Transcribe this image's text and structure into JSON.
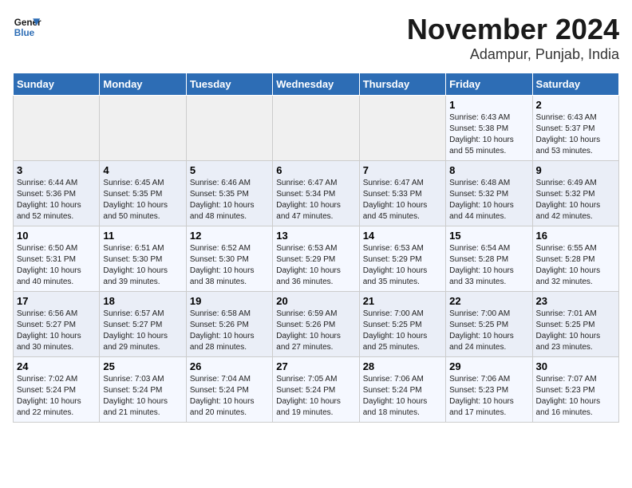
{
  "header": {
    "logo_line1": "General",
    "logo_line2": "Blue",
    "month": "November 2024",
    "location": "Adampur, Punjab, India"
  },
  "weekdays": [
    "Sunday",
    "Monday",
    "Tuesday",
    "Wednesday",
    "Thursday",
    "Friday",
    "Saturday"
  ],
  "weeks": [
    [
      {
        "day": "",
        "info": ""
      },
      {
        "day": "",
        "info": ""
      },
      {
        "day": "",
        "info": ""
      },
      {
        "day": "",
        "info": ""
      },
      {
        "day": "",
        "info": ""
      },
      {
        "day": "1",
        "info": "Sunrise: 6:43 AM\nSunset: 5:38 PM\nDaylight: 10 hours and 55 minutes."
      },
      {
        "day": "2",
        "info": "Sunrise: 6:43 AM\nSunset: 5:37 PM\nDaylight: 10 hours and 53 minutes."
      }
    ],
    [
      {
        "day": "3",
        "info": "Sunrise: 6:44 AM\nSunset: 5:36 PM\nDaylight: 10 hours and 52 minutes."
      },
      {
        "day": "4",
        "info": "Sunrise: 6:45 AM\nSunset: 5:35 PM\nDaylight: 10 hours and 50 minutes."
      },
      {
        "day": "5",
        "info": "Sunrise: 6:46 AM\nSunset: 5:35 PM\nDaylight: 10 hours and 48 minutes."
      },
      {
        "day": "6",
        "info": "Sunrise: 6:47 AM\nSunset: 5:34 PM\nDaylight: 10 hours and 47 minutes."
      },
      {
        "day": "7",
        "info": "Sunrise: 6:47 AM\nSunset: 5:33 PM\nDaylight: 10 hours and 45 minutes."
      },
      {
        "day": "8",
        "info": "Sunrise: 6:48 AM\nSunset: 5:32 PM\nDaylight: 10 hours and 44 minutes."
      },
      {
        "day": "9",
        "info": "Sunrise: 6:49 AM\nSunset: 5:32 PM\nDaylight: 10 hours and 42 minutes."
      }
    ],
    [
      {
        "day": "10",
        "info": "Sunrise: 6:50 AM\nSunset: 5:31 PM\nDaylight: 10 hours and 40 minutes."
      },
      {
        "day": "11",
        "info": "Sunrise: 6:51 AM\nSunset: 5:30 PM\nDaylight: 10 hours and 39 minutes."
      },
      {
        "day": "12",
        "info": "Sunrise: 6:52 AM\nSunset: 5:30 PM\nDaylight: 10 hours and 38 minutes."
      },
      {
        "day": "13",
        "info": "Sunrise: 6:53 AM\nSunset: 5:29 PM\nDaylight: 10 hours and 36 minutes."
      },
      {
        "day": "14",
        "info": "Sunrise: 6:53 AM\nSunset: 5:29 PM\nDaylight: 10 hours and 35 minutes."
      },
      {
        "day": "15",
        "info": "Sunrise: 6:54 AM\nSunset: 5:28 PM\nDaylight: 10 hours and 33 minutes."
      },
      {
        "day": "16",
        "info": "Sunrise: 6:55 AM\nSunset: 5:28 PM\nDaylight: 10 hours and 32 minutes."
      }
    ],
    [
      {
        "day": "17",
        "info": "Sunrise: 6:56 AM\nSunset: 5:27 PM\nDaylight: 10 hours and 30 minutes."
      },
      {
        "day": "18",
        "info": "Sunrise: 6:57 AM\nSunset: 5:27 PM\nDaylight: 10 hours and 29 minutes."
      },
      {
        "day": "19",
        "info": "Sunrise: 6:58 AM\nSunset: 5:26 PM\nDaylight: 10 hours and 28 minutes."
      },
      {
        "day": "20",
        "info": "Sunrise: 6:59 AM\nSunset: 5:26 PM\nDaylight: 10 hours and 27 minutes."
      },
      {
        "day": "21",
        "info": "Sunrise: 7:00 AM\nSunset: 5:25 PM\nDaylight: 10 hours and 25 minutes."
      },
      {
        "day": "22",
        "info": "Sunrise: 7:00 AM\nSunset: 5:25 PM\nDaylight: 10 hours and 24 minutes."
      },
      {
        "day": "23",
        "info": "Sunrise: 7:01 AM\nSunset: 5:25 PM\nDaylight: 10 hours and 23 minutes."
      }
    ],
    [
      {
        "day": "24",
        "info": "Sunrise: 7:02 AM\nSunset: 5:24 PM\nDaylight: 10 hours and 22 minutes."
      },
      {
        "day": "25",
        "info": "Sunrise: 7:03 AM\nSunset: 5:24 PM\nDaylight: 10 hours and 21 minutes."
      },
      {
        "day": "26",
        "info": "Sunrise: 7:04 AM\nSunset: 5:24 PM\nDaylight: 10 hours and 20 minutes."
      },
      {
        "day": "27",
        "info": "Sunrise: 7:05 AM\nSunset: 5:24 PM\nDaylight: 10 hours and 19 minutes."
      },
      {
        "day": "28",
        "info": "Sunrise: 7:06 AM\nSunset: 5:24 PM\nDaylight: 10 hours and 18 minutes."
      },
      {
        "day": "29",
        "info": "Sunrise: 7:06 AM\nSunset: 5:23 PM\nDaylight: 10 hours and 17 minutes."
      },
      {
        "day": "30",
        "info": "Sunrise: 7:07 AM\nSunset: 5:23 PM\nDaylight: 10 hours and 16 minutes."
      }
    ]
  ]
}
